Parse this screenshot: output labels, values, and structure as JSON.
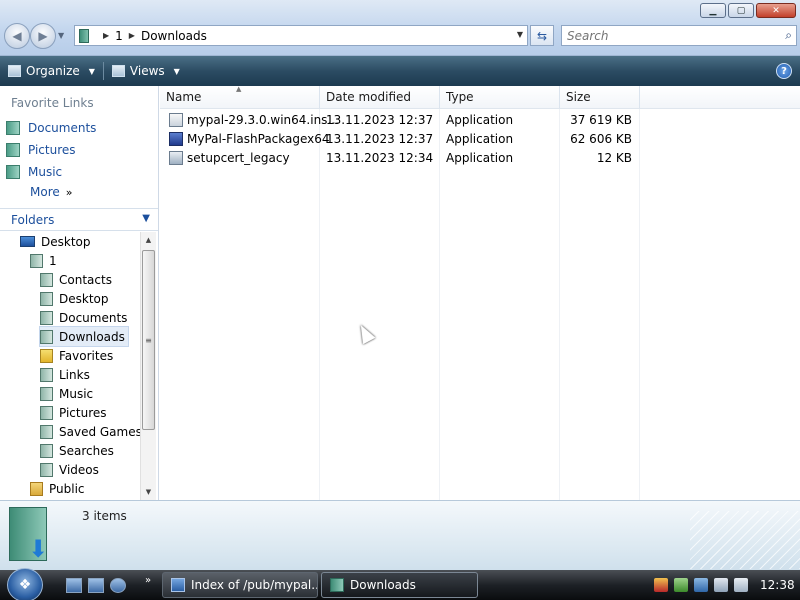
{
  "address_bar": {
    "path": [
      "1",
      "Downloads"
    ]
  },
  "search": {
    "placeholder": "Search"
  },
  "toolbar": {
    "organize_label": "Organize",
    "views_label": "Views",
    "help_label": "?"
  },
  "favorite_links": {
    "title": "Favorite Links",
    "items": [
      {
        "label": "Documents",
        "icon": "documents-folder-icon"
      },
      {
        "label": "Pictures",
        "icon": "pictures-folder-icon"
      },
      {
        "label": "Music",
        "icon": "music-folder-icon"
      }
    ],
    "more_label": "More",
    "more_chevron": "»"
  },
  "folders": {
    "title": "Folders",
    "tree": [
      {
        "label": "Desktop",
        "icon": "desktop-icon",
        "level": 0
      },
      {
        "label": "1",
        "icon": "user-folder-icon",
        "level": 1
      },
      {
        "label": "Contacts",
        "icon": "contacts-folder-icon",
        "level": 2
      },
      {
        "label": "Desktop",
        "icon": "desktop-folder-icon",
        "level": 2
      },
      {
        "label": "Documents",
        "icon": "documents-folder-icon",
        "level": 2
      },
      {
        "label": "Downloads",
        "icon": "downloads-folder-icon",
        "level": 2,
        "selected": true
      },
      {
        "label": "Favorites",
        "icon": "favorites-folder-icon",
        "level": 2
      },
      {
        "label": "Links",
        "icon": "links-folder-icon",
        "level": 2
      },
      {
        "label": "Music",
        "icon": "music-folder-icon",
        "level": 2
      },
      {
        "label": "Pictures",
        "icon": "pictures-folder-icon",
        "level": 2
      },
      {
        "label": "Saved Games",
        "icon": "saved-games-folder-icon",
        "level": 2
      },
      {
        "label": "Searches",
        "icon": "searches-folder-icon",
        "level": 2
      },
      {
        "label": "Videos",
        "icon": "videos-folder-icon",
        "level": 2
      },
      {
        "label": "Public",
        "icon": "public-folder-icon",
        "level": 1
      }
    ]
  },
  "file_list": {
    "columns": [
      "Name",
      "Date modified",
      "Type",
      "Size"
    ],
    "rows": [
      {
        "name": "mypal-29.3.0.win64.ins...",
        "date": "13.11.2023 12:37",
        "type": "Application",
        "size": "37 619 KB",
        "icon": "installer-icon"
      },
      {
        "name": "MyPal-FlashPackagex64",
        "date": "13.11.2023 12:37",
        "type": "Application",
        "size": "62 606 KB",
        "icon": "package-icon"
      },
      {
        "name": "setupcert_legacy",
        "date": "13.11.2023 12:34",
        "type": "Application",
        "size": "12 KB",
        "icon": "application-icon"
      }
    ]
  },
  "details_pane": {
    "item_count": "3 items"
  },
  "taskbar": {
    "tasks": [
      {
        "label": "Index of /pub/mypal...",
        "icon": "internet-explorer-icon"
      },
      {
        "label": "Downloads",
        "icon": "folder-icon",
        "active": true
      }
    ],
    "clock": "12:38"
  }
}
